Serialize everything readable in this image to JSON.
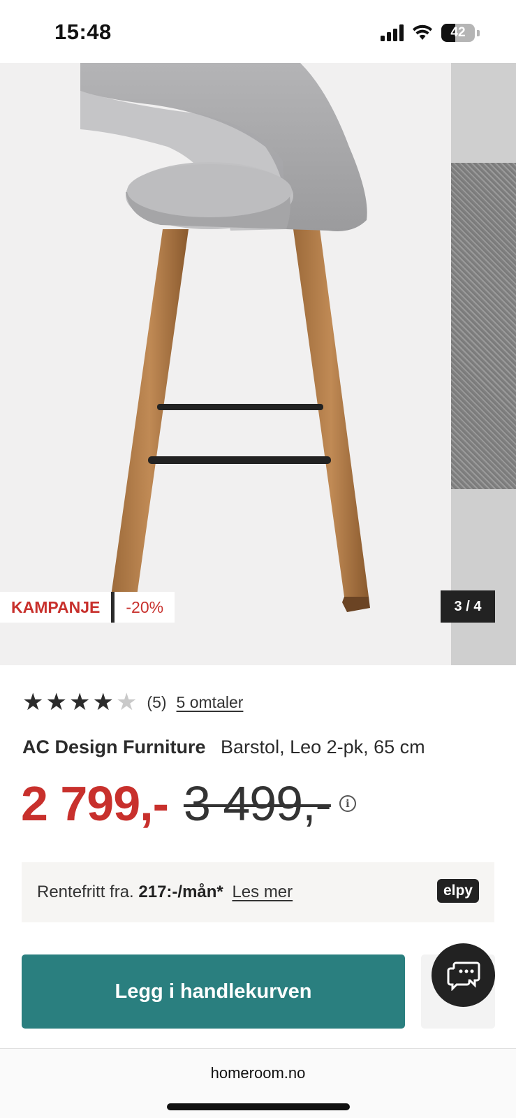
{
  "status_bar": {
    "time": "15:48",
    "battery": "42",
    "battery_level": 0.42
  },
  "gallery": {
    "badges": {
      "campaign": "KAMPANJE",
      "discount": "-20%"
    },
    "counter": "3 / 4"
  },
  "product": {
    "rating": {
      "value": 4,
      "max": 5,
      "count": "(5)",
      "reviews_link": "5 omtaler"
    },
    "brand": "AC Design Furniture",
    "name": "Barstol, Leo 2-pk, 65 cm",
    "price_current": "2 799,-",
    "price_old": "3 499,-",
    "price_info_icon": "info-icon"
  },
  "financing": {
    "prefix": "Rentefritt fra.",
    "amount": "217:-/mån*",
    "link": "Les mer",
    "logo": "elpy"
  },
  "actions": {
    "add_to_cart": "Legg i handlekurven",
    "chat_icon": "chat-icon"
  },
  "browser": {
    "url": "homeroom.no"
  },
  "colors": {
    "accent_red": "#c8302c",
    "cta_teal": "#2a7f7f",
    "dark": "#222222"
  }
}
